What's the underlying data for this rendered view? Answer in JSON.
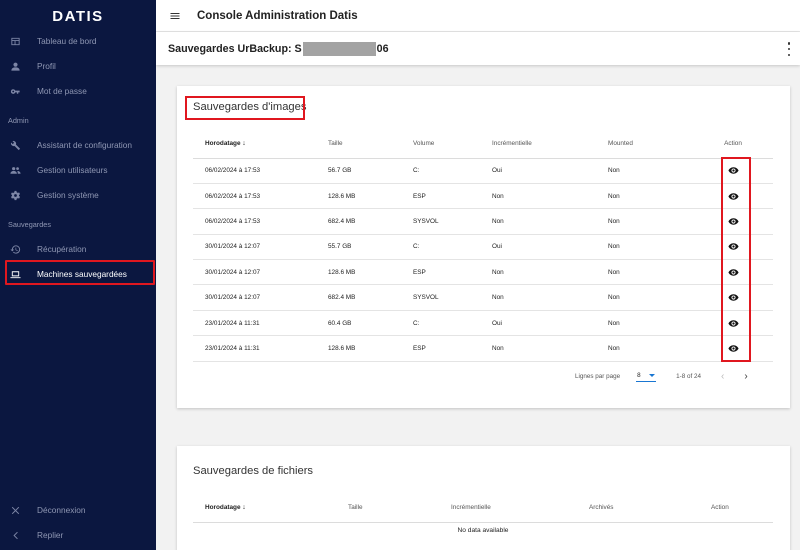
{
  "sidebar": {
    "logo": "DATIS",
    "items": [
      {
        "label": "Tableau de bord",
        "icon": "dashboard-icon"
      },
      {
        "label": "Profil",
        "icon": "person-icon"
      },
      {
        "label": "Mot de passe",
        "icon": "key-icon"
      },
      {
        "label": "Assistant de configuration",
        "icon": "wrench-icon"
      },
      {
        "label": "Gestion utilisateurs",
        "icon": "users-icon"
      },
      {
        "label": "Gestion système",
        "icon": "gear-icon"
      },
      {
        "label": "Récupération",
        "icon": "history-icon"
      },
      {
        "label": "Machines sauvegardées",
        "icon": "laptop-icon",
        "active": true
      },
      {
        "label": "Déconnexion",
        "icon": "close-icon"
      },
      {
        "label": "Replier",
        "icon": "chevron-left-icon"
      }
    ],
    "sections": [
      "Admin",
      "Sauvegardes"
    ]
  },
  "topbar": {
    "title": "Console Administration Datis"
  },
  "subheader": {
    "title_prefix": "Sauvegardes UrBackup: S",
    "title_suffix": "06"
  },
  "images": {
    "title": "Sauvegardes d'images",
    "headers": [
      "Horodatage",
      "Taille",
      "Volume",
      "Incrémentielle",
      "Mounted",
      "Action"
    ],
    "rows": [
      [
        "06/02/2024 à 17:53",
        "56.7 GB",
        "C:",
        "Oui",
        "Non"
      ],
      [
        "06/02/2024 à 17:53",
        "128.6 MB",
        "ESP",
        "Non",
        "Non"
      ],
      [
        "06/02/2024 à 17:53",
        "682.4 MB",
        "SYSVOL",
        "Non",
        "Non"
      ],
      [
        "30/01/2024 à 12:07",
        "55.7 GB",
        "C:",
        "Oui",
        "Non"
      ],
      [
        "30/01/2024 à 12:07",
        "128.6 MB",
        "ESP",
        "Non",
        "Non"
      ],
      [
        "30/01/2024 à 12:07",
        "682.4 MB",
        "SYSVOL",
        "Non",
        "Non"
      ],
      [
        "23/01/2024 à 11:31",
        "60.4 GB",
        "C:",
        "Oui",
        "Non"
      ],
      [
        "23/01/2024 à 11:31",
        "128.6 MB",
        "ESP",
        "Non",
        "Non"
      ]
    ],
    "pager": {
      "label": "Lignes par page",
      "value": "8",
      "range": "1-8 of 24"
    }
  },
  "files": {
    "title": "Sauvegardes de fichiers",
    "headers": [
      "Horodatage",
      "Taille",
      "Incrémentielle",
      "Archivés",
      "Action"
    ],
    "empty": "No data available"
  },
  "colors": {
    "sidebar": "#0b1740",
    "highlight": "#e0171f",
    "accent": "#1976d2"
  }
}
